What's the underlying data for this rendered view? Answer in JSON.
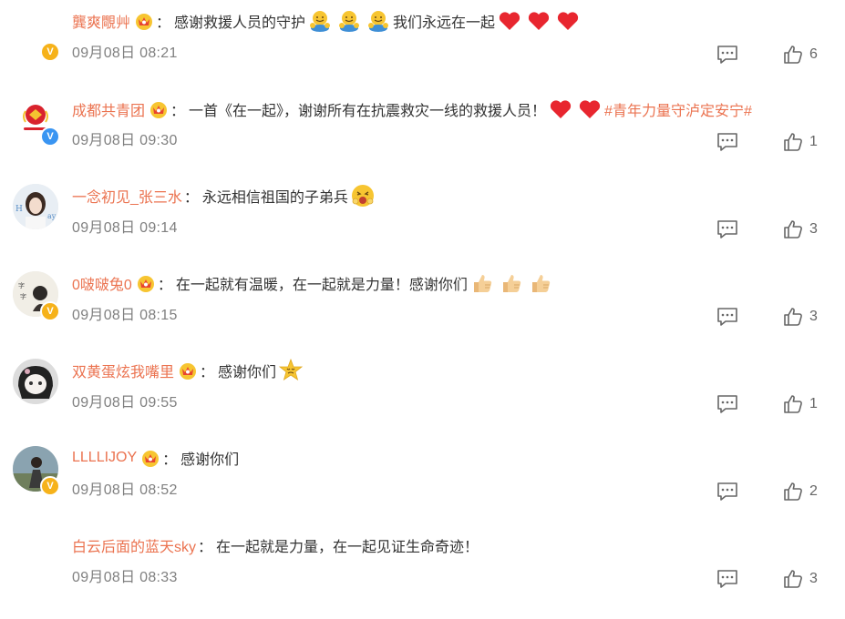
{
  "comments": [
    {
      "username": "龔爽覸艸",
      "segments": [
        "感谢救援人员的守护",
        "我们永远在一起"
      ],
      "time": "09月08日 08:21",
      "likes": "6",
      "badge": "gold",
      "has_crown": true
    },
    {
      "username": "成都共青团",
      "segments": [
        "一首《在一起》，谢谢所有在抗震救灾一线的救援人员！",
        "#青年力量守泸定安宁#"
      ],
      "time": "09月08日 09:30",
      "likes": "1",
      "badge": "blue",
      "has_crown": true
    },
    {
      "username": "一念初见_张三水",
      "segments": [
        "永远相信祖国的子弟兵"
      ],
      "time": "09月08日 09:14",
      "likes": "3",
      "badge": "none",
      "has_crown": false
    },
    {
      "username": "0啵啵兔0",
      "segments": [
        "在一起就有温暖，在一起就是力量！感谢你们"
      ],
      "time": "09月08日 08:15",
      "likes": "3",
      "badge": "gold",
      "has_crown": true
    },
    {
      "username": "双黄蛋炫我嘴里",
      "segments": [
        "感谢你们"
      ],
      "time": "09月08日 09:55",
      "likes": "1",
      "badge": "none",
      "has_crown": true
    },
    {
      "username": "LLLLIJOY",
      "segments": [
        "感谢你们"
      ],
      "time": "09月08日 08:52",
      "likes": "2",
      "badge": "gold",
      "has_crown": true
    },
    {
      "username": "白云后面的蓝天sky",
      "segments": [
        "在一起就是力量，在一起见证生命奇迹！"
      ],
      "time": "09月08日 08:33",
      "likes": "3",
      "badge": "none",
      "has_crown": false
    }
  ],
  "colors": {
    "username": "#eb7350",
    "text": "#333333",
    "time": "#808080",
    "badge_gold": "#f6b21a",
    "badge_blue": "#3a95f2"
  },
  "icons": {
    "reply": "comment-icon",
    "like": "thumbs-up-icon",
    "crown": "vip-crown-icon",
    "emoji_hug": "hug-emoji",
    "emoji_heart": "red-heart-emoji",
    "emoji_thumb": "thumbs-up-emoji",
    "emoji_excited": "excited-face-emoji",
    "emoji_cry": "crying-face-emoji"
  },
  "badge_glyph": "V",
  "separator": "："
}
